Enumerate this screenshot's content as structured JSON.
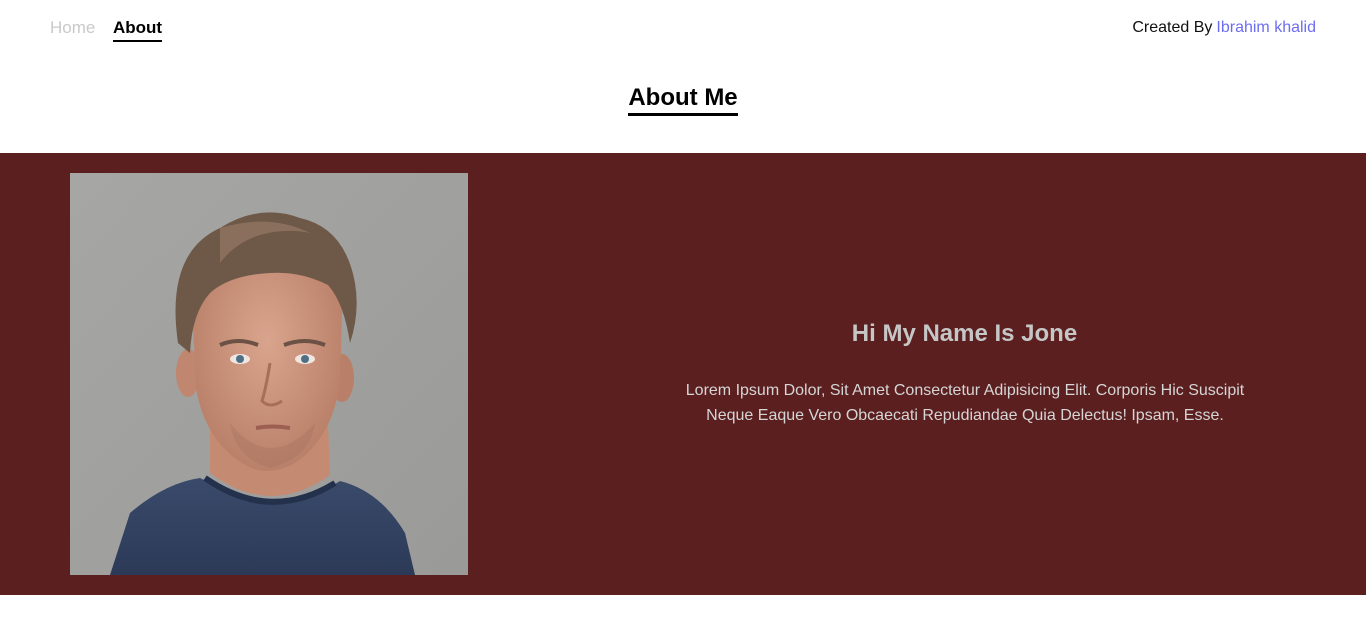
{
  "nav": {
    "items": [
      {
        "label": "Home",
        "active": false
      },
      {
        "label": "About",
        "active": true
      }
    ],
    "credit_prefix": "Created By",
    "credit_author": "Ibrahim khalid",
    "credit_author_color": "#6d6df0"
  },
  "page": {
    "title": "About Me"
  },
  "about": {
    "band_color": "#5b1f20",
    "photo_icon": "portrait-photo",
    "heading": "Hi My Name Is Jone",
    "text": "Lorem Ipsum Dolor, Sit Amet Consectetur Adipisicing Elit. Corporis Hic Suscipit Neque Eaque Vero Obcaecati Repudiandae Quia Delectus! Ipsam, Esse."
  }
}
